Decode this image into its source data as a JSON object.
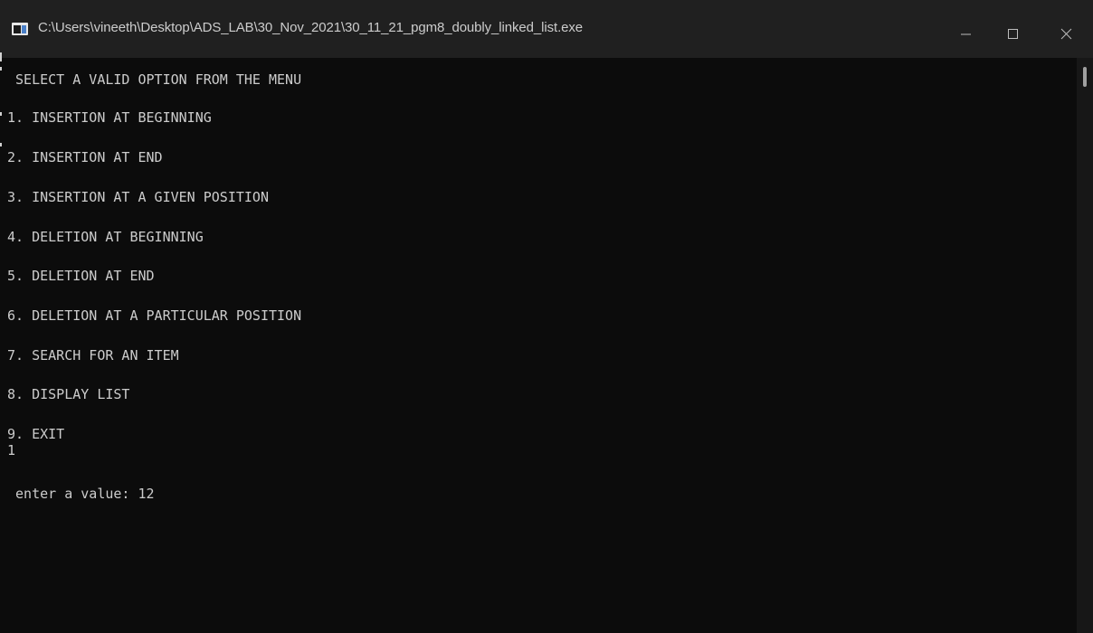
{
  "window": {
    "title": "C:\\Users\\vineeth\\Desktop\\ADS_LAB\\30_Nov_2021\\30_11_21_pgm8_doubly_linked_list.exe"
  },
  "console": {
    "header": " SELECT A VALID OPTION FROM THE MENU",
    "menu": [
      "1. INSERTION AT BEGINNING",
      "2. INSERTION AT END",
      "3. INSERTION AT A GIVEN POSITION",
      "4. DELETION AT BEGINNING",
      "5. DELETION AT END",
      "6. DELETION AT A PARTICULAR POSITION",
      "7. SEARCH FOR AN ITEM",
      "8. DISPLAY LIST",
      "9. EXIT"
    ],
    "user_choice": "1",
    "value_prompt": " enter a value: 12"
  },
  "colors": {
    "background": "#0c0c0c",
    "titlebar": "#202020",
    "text": "#cccccc"
  },
  "icons": [
    "console-app-icon",
    "minimize-icon",
    "maximize-icon",
    "close-icon"
  ]
}
